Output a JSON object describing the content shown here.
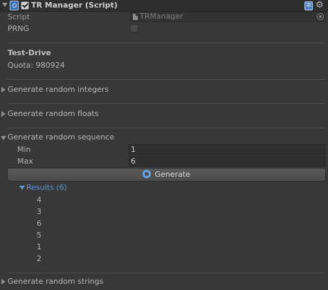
{
  "header": {
    "title": "TR Manager (Script)",
    "enabled": true,
    "icons": [
      "foldout-arrow-icon",
      "script-icon",
      "help-book-icon",
      "gear-icon"
    ]
  },
  "fields": {
    "script_label": "Script",
    "script_value": "TRManager",
    "prng_label": "PRNG",
    "prng_checked": false
  },
  "test_drive": {
    "heading": "Test-Drive",
    "quota": "Quota: 980924"
  },
  "sections": {
    "integers": "Generate random integers",
    "floats": "Generate random floats",
    "sequence": "Generate random sequence",
    "strings": "Generate random strings"
  },
  "sequence": {
    "min_label": "Min",
    "min_value": "1",
    "max_label": "Max",
    "max_value": "6",
    "generate_label": "Generate"
  },
  "results": {
    "label": "Results (6)",
    "items": [
      "4",
      "3",
      "6",
      "5",
      "1",
      "2"
    ]
  },
  "colors": {
    "background": "#383838",
    "accent": "#5f95d8"
  }
}
